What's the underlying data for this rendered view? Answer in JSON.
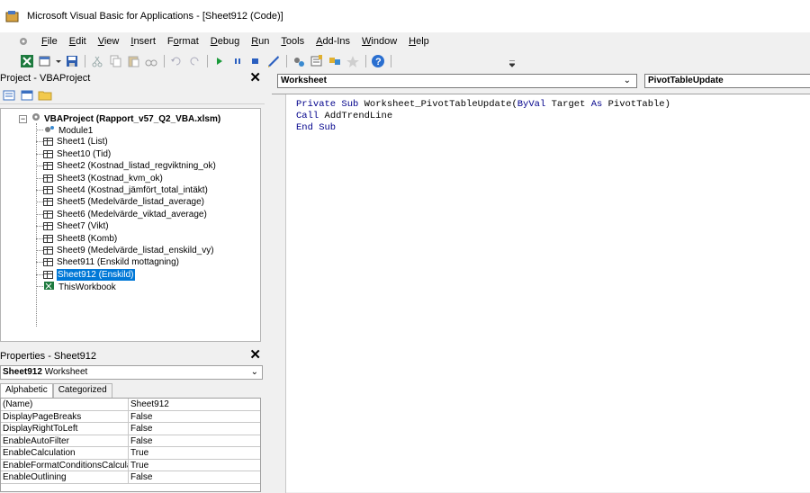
{
  "window": {
    "title": "Microsoft Visual Basic for Applications - [Sheet912 (Code)]"
  },
  "menu": [
    {
      "key": "F",
      "rest": "ile"
    },
    {
      "key": "E",
      "rest": "dit"
    },
    {
      "key": "V",
      "rest": "iew"
    },
    {
      "key": "I",
      "rest": "nsert"
    },
    {
      "pre": "F",
      "key": "o",
      "rest": "rmat"
    },
    {
      "key": "D",
      "rest": "ebug"
    },
    {
      "key": "R",
      "rest": "un"
    },
    {
      "key": "T",
      "rest": "ools"
    },
    {
      "key": "A",
      "rest": "dd-Ins"
    },
    {
      "key": "W",
      "rest": "indow"
    },
    {
      "key": "H",
      "rest": "elp"
    }
  ],
  "project_pane": {
    "title": "Project - VBAProject",
    "root": "VBAProject (Rapport_v57_Q2_VBA.xlsm)",
    "items": [
      "Module1",
      "Sheet1 (List)",
      "Sheet10 (Tid)",
      "Sheet2 (Kostnad_listad_regviktning_ok)",
      "Sheet3 (Kostnad_kvm_ok)",
      "Sheet4 (Kostnad_jämfört_total_intäkt)",
      "Sheet5 (Medelvärde_listad_average)",
      "Sheet6 (Medelvärde_viktad_average)",
      "Sheet7 (Vikt)",
      "Sheet8 (Komb)",
      "Sheet9 (Medelvärde_listad_enskild_vy)",
      "Sheet911 (Enskild mottagning)",
      "Sheet912 (Enskild)",
      "ThisWorkbook"
    ],
    "selected_index": 12
  },
  "properties_pane": {
    "title": "Properties - Sheet912",
    "object_name": "Sheet912",
    "object_type": "Worksheet",
    "tabs": [
      "Alphabetic",
      "Categorized"
    ],
    "rows": [
      {
        "name": "(Name)",
        "value": "Sheet912"
      },
      {
        "name": "DisplayPageBreaks",
        "value": "False"
      },
      {
        "name": "DisplayRightToLeft",
        "value": "False"
      },
      {
        "name": "EnableAutoFilter",
        "value": "False"
      },
      {
        "name": "EnableCalculation",
        "value": "True"
      },
      {
        "name": "EnableFormatConditionsCalculation",
        "value": "True"
      },
      {
        "name": "EnableOutlining",
        "value": "False"
      }
    ]
  },
  "code_window": {
    "object_combo": "Worksheet",
    "procedure_combo": "PivotTableUpdate",
    "lines": [
      "Private Sub Worksheet_PivotTableUpdate(ByVal Target As PivotTable)",
      "Call AddTrendLine",
      "End Sub"
    ]
  },
  "colors": {
    "selection": "#0078d7",
    "keyword": "#00008b"
  }
}
